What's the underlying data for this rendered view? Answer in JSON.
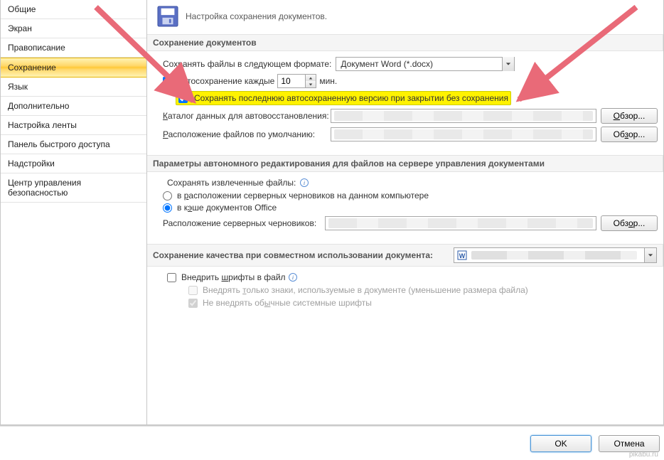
{
  "sidebar": {
    "items": [
      "Общие",
      "Экран",
      "Правописание",
      "Сохранение",
      "Язык",
      "Дополнительно",
      "Настройка ленты",
      "Панель быстрого доступа",
      "Надстройки",
      "Центр управления безопасностью"
    ],
    "selected": 3
  },
  "header": {
    "title": "Настройка сохранения документов."
  },
  "group_save": {
    "title": "Сохранение документов",
    "format_label_prefix": "Сохранять файлы в сл",
    "format_label_u": "е",
    "format_label_suffix": "дующем формате:",
    "format_value": "Документ Word (*.docx)",
    "autosave_u": "А",
    "autosave_label": "втосохранение каждые",
    "autosave_value": "10",
    "autosave_unit": "мин.",
    "keep_last": "Сохранять последнюю автосохраненную версию при закрытии без сохранения",
    "recovery_u": "К",
    "recovery_label": "аталог данных для автовосстановления:",
    "default_loc_prefix": "",
    "default_loc_u": "Р",
    "default_loc_label": "асположение файлов по умолчанию:",
    "browse": "Обзор...",
    "browse_u": "О"
  },
  "group_offline": {
    "title": "Параметры автономного редактирования для файлов на сервере управления документами",
    "save_ext_label": "Сохранять извлеченные файлы:",
    "opt1_prefix": "в ",
    "opt1_u": "р",
    "opt1_suffix": "асположении серверных черновиков на данном компьютере",
    "opt2_prefix": "в к",
    "opt2_u": "э",
    "opt2_suffix": "ше документов Office",
    "drafts_label": "Расположение серверных черновиков:",
    "browse": "Обзор...",
    "browse_u": "о"
  },
  "group_quality": {
    "title": "Сохранение качества при совместном использовании документа:",
    "embed_prefix": "Внедрить ",
    "embed_u": "ш",
    "embed_suffix": "рифты в файл",
    "sub1_prefix": "Внедрять ",
    "sub1_u": "т",
    "sub1_suffix": "олько знаки, используемые в документе (уменьшение размера файла)",
    "sub2_prefix": "Не внедрять об",
    "sub2_u": "ы",
    "sub2_suffix": "чные системные шрифты"
  },
  "footer": {
    "ok": "OK",
    "cancel": "Отмена"
  },
  "watermark": "pikabu.ru"
}
